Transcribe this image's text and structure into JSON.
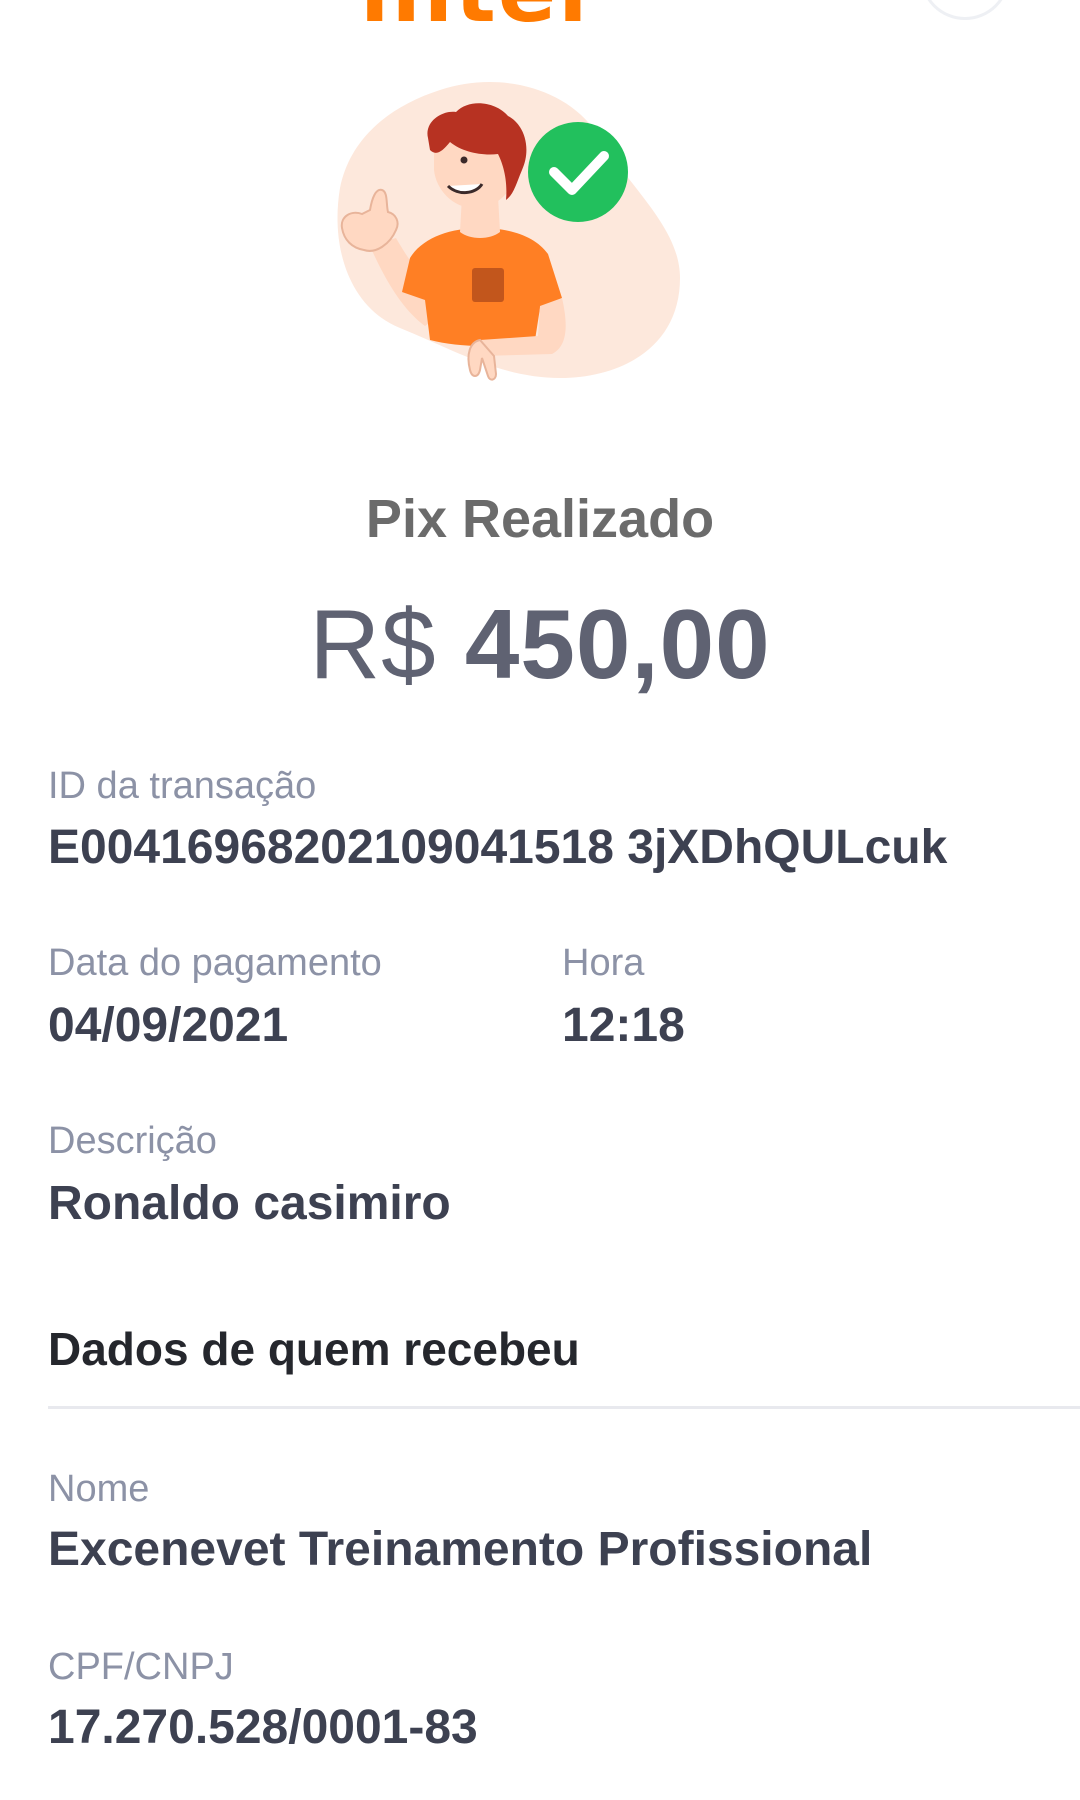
{
  "header": {
    "logo_fragment": "inter"
  },
  "status": {
    "title": "Pix Realizado",
    "currency": "R$",
    "amount": "450,00",
    "colors": {
      "accent": "#ff7a00",
      "success": "#22c05d"
    },
    "illustration_icon": "success-person-illustration"
  },
  "transaction": {
    "id_label": "ID da transação",
    "id_value": "E00416968202109041518 3jXDhQULcuk",
    "date_label": "Data do pagamento",
    "date_value": "04/09/2021",
    "time_label": "Hora",
    "time_value": "12:18",
    "description_label": "Descrição",
    "description_value": "Ronaldo casimiro"
  },
  "recipient": {
    "section_title": "Dados de quem recebeu",
    "name_label": "Nome",
    "name_value": "Excenevet Treinamento Profissional",
    "doc_label": "CPF/CNPJ",
    "doc_value": "17.270.528/0001-83"
  }
}
